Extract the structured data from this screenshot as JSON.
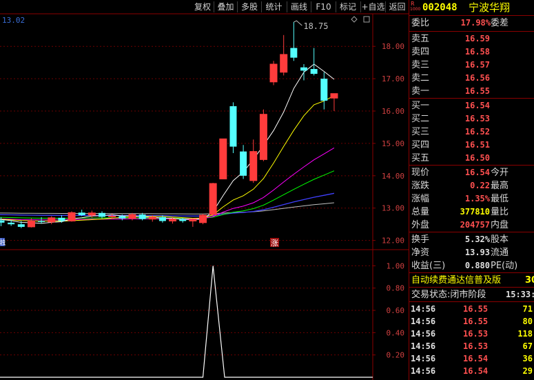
{
  "toolbar": {
    "buttons": [
      "复权",
      "叠加",
      "多股",
      "统计",
      "画线",
      "F10",
      "标记",
      "+自选",
      "返回"
    ]
  },
  "chart": {
    "ma_readout": "13.02",
    "high_annotation": "18.75",
    "price_axis": [
      "18.00",
      "17.00",
      "16.00",
      "15.00",
      "14.00",
      "13.00",
      "12.00"
    ],
    "indicator_axis": [
      "1.00",
      "0.80",
      "0.60",
      "0.40",
      "0.20"
    ],
    "left_marker": "融",
    "zhang_marker": "涨",
    "colors": {
      "up": "#ff3c3c",
      "down": "#54ffff",
      "ma5": "#ffffff",
      "ma10": "#ffff00",
      "ma20": "#ff00ff",
      "ma30": "#00ff00",
      "ma60": "#4040ff",
      "ma120": "#c0c0c0"
    }
  },
  "chart_data": [
    {
      "type": "candlestick",
      "title": "",
      "ylim": [
        11.8,
        18.9
      ],
      "candles": [
        {
          "o": 12.62,
          "h": 12.72,
          "l": 12.44,
          "c": 12.55
        },
        {
          "o": 12.55,
          "h": 12.63,
          "l": 12.45,
          "c": 12.5
        },
        {
          "o": 12.5,
          "h": 12.6,
          "l": 12.38,
          "c": 12.42
        },
        {
          "o": 12.42,
          "h": 12.68,
          "l": 12.4,
          "c": 12.6
        },
        {
          "o": 12.6,
          "h": 12.72,
          "l": 12.52,
          "c": 12.57
        },
        {
          "o": 12.57,
          "h": 12.75,
          "l": 12.5,
          "c": 12.7
        },
        {
          "o": 12.7,
          "h": 12.78,
          "l": 12.55,
          "c": 12.6
        },
        {
          "o": 12.6,
          "h": 12.9,
          "l": 12.58,
          "c": 12.86
        },
        {
          "o": 12.86,
          "h": 12.95,
          "l": 12.75,
          "c": 12.78
        },
        {
          "o": 12.78,
          "h": 12.92,
          "l": 12.7,
          "c": 12.85
        },
        {
          "o": 12.85,
          "h": 12.9,
          "l": 12.68,
          "c": 12.73
        },
        {
          "o": 12.73,
          "h": 12.82,
          "l": 12.65,
          "c": 12.75
        },
        {
          "o": 12.75,
          "h": 12.8,
          "l": 12.62,
          "c": 12.68
        },
        {
          "o": 12.68,
          "h": 12.85,
          "l": 12.62,
          "c": 12.8
        },
        {
          "o": 12.8,
          "h": 12.85,
          "l": 12.62,
          "c": 12.66
        },
        {
          "o": 12.66,
          "h": 12.78,
          "l": 12.58,
          "c": 12.72
        },
        {
          "o": 12.72,
          "h": 12.78,
          "l": 12.55,
          "c": 12.6
        },
        {
          "o": 12.6,
          "h": 12.72,
          "l": 12.52,
          "c": 12.66
        },
        {
          "o": 12.66,
          "h": 12.7,
          "l": 12.55,
          "c": 12.6
        },
        {
          "o": 12.6,
          "h": 12.68,
          "l": 12.42,
          "c": 12.65
        },
        {
          "o": 12.55,
          "h": 12.82,
          "l": 12.5,
          "c": 12.78
        },
        {
          "o": 12.8,
          "h": 13.78,
          "l": 12.75,
          "c": 13.76
        },
        {
          "o": 13.9,
          "h": 14.05,
          "l": 13.9,
          "c": 15.14
        },
        {
          "o": 16.15,
          "h": 16.27,
          "l": 14.7,
          "c": 14.9
        },
        {
          "o": 14.75,
          "h": 14.95,
          "l": 13.9,
          "c": 14.0
        },
        {
          "o": 13.85,
          "h": 15.12,
          "l": 13.78,
          "c": 14.75
        },
        {
          "o": 14.5,
          "h": 16.05,
          "l": 14.45,
          "c": 15.9
        },
        {
          "o": 16.9,
          "h": 17.55,
          "l": 16.8,
          "c": 17.45
        },
        {
          "o": 17.2,
          "h": 18.35,
          "l": 17.1,
          "c": 17.75
        },
        {
          "o": 17.95,
          "h": 18.75,
          "l": 17.55,
          "c": 17.65
        },
        {
          "o": 17.35,
          "h": 17.45,
          "l": 16.95,
          "c": 17.25
        },
        {
          "o": 17.3,
          "h": 17.95,
          "l": 17.1,
          "c": 17.15
        },
        {
          "o": 17.0,
          "h": 17.2,
          "l": 16.05,
          "c": 16.32
        },
        {
          "o": 16.4,
          "h": 16.5,
          "l": 16.0,
          "c": 16.54
        }
      ]
    },
    {
      "type": "line",
      "title": "",
      "ylim": [
        0,
        1.12
      ],
      "values": [
        0,
        0,
        0,
        0,
        0,
        0,
        0,
        0,
        0,
        0,
        0,
        0,
        0,
        0,
        0,
        0,
        0,
        0,
        0,
        0,
        0,
        1.0,
        0,
        0,
        0,
        0,
        0,
        0,
        0,
        0,
        0,
        0,
        0,
        0
      ]
    }
  ],
  "quote": {
    "r_badge": "R",
    "stock_code": "002048",
    "stock_name": "宁波华翔",
    "weibi_label": "委比",
    "weibi_value": "17.98%",
    "weicha_label": "委差",
    "asks": [
      {
        "label": "卖五",
        "price": "16.59"
      },
      {
        "label": "卖四",
        "price": "16.58"
      },
      {
        "label": "卖三",
        "price": "16.57"
      },
      {
        "label": "卖二",
        "price": "16.56"
      },
      {
        "label": "卖一",
        "price": "16.55"
      }
    ],
    "bids": [
      {
        "label": "买一",
        "price": "16.54"
      },
      {
        "label": "买二",
        "price": "16.53"
      },
      {
        "label": "买三",
        "price": "16.52"
      },
      {
        "label": "买四",
        "price": "16.51"
      },
      {
        "label": "买五",
        "price": "16.50"
      }
    ],
    "stats": [
      {
        "label": "现价",
        "value": "16.54",
        "label2": "今开"
      },
      {
        "label": "涨跌",
        "value": "0.22",
        "label2": "最高"
      },
      {
        "label": "涨幅",
        "value": "1.35%",
        "label2": "最低"
      },
      {
        "label": "总量",
        "value": "377810",
        "label2": "量比"
      },
      {
        "label": "外盘",
        "value": "204757",
        "label2": "内盘"
      }
    ],
    "fundamentals": [
      {
        "label": "换手",
        "value": "5.32%",
        "label2": "股本"
      },
      {
        "label": "净资",
        "value": "13.93",
        "label2": "流通"
      },
      {
        "label": "收益(三)",
        "value": "0.880",
        "label2": "PE(动)"
      }
    ],
    "promo": "自动续费通达信普及版",
    "promo_suffix": "30",
    "status": "交易状态:闭市阶段",
    "status_time": "15:33:",
    "ticks": [
      {
        "time": "14:56",
        "price": "16.55",
        "vol": "71"
      },
      {
        "time": "14:56",
        "price": "16.55",
        "vol": "80"
      },
      {
        "time": "14:56",
        "price": "16.53",
        "vol": "118"
      },
      {
        "time": "14:56",
        "price": "16.53",
        "vol": "67"
      },
      {
        "time": "14:56",
        "price": "16.54",
        "vol": "36"
      },
      {
        "time": "14:56",
        "price": "16.54",
        "vol": "29"
      }
    ]
  }
}
